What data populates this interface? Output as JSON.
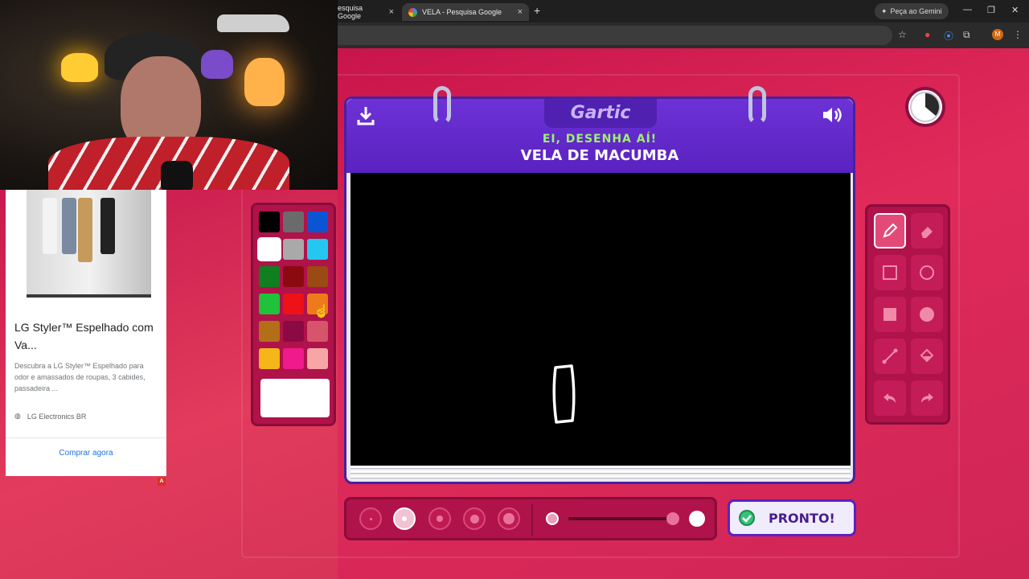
{
  "browser": {
    "tabs": [
      {
        "title": "esquisa Google",
        "close": "×"
      },
      {
        "title": "VELA - Pesquisa Google",
        "close": "×"
      }
    ],
    "new_tab": "+",
    "gemini_label": "Peça ao Gemini",
    "window_controls": {
      "minimize": "—",
      "restore": "❐",
      "close": "✕"
    },
    "profile_initial": "M"
  },
  "ad": {
    "title": "LG Styler™ Espelhado com Va...",
    "description": "Descubra a LG Styler™ Espelhado para odor e amassados de roupas, 3 cabides, passadeira ...",
    "source": "LG Electronics BR",
    "cta": "Comprar agora",
    "badge": "A"
  },
  "game": {
    "logo": "Gartic",
    "subtitle": "EI, DESENHA AÍ!",
    "word": "VELA DE MACUMBA",
    "palette": {
      "colors": [
        [
          "#000000",
          "#6b6b6b",
          "#0b55d4"
        ],
        [
          "#ffffff",
          "#a9a9a9",
          "#26c6f2"
        ],
        [
          "#0f7f1f",
          "#8a0a10",
          "#9a4a12"
        ],
        [
          "#1fc23a",
          "#ee1118",
          "#ef7a1c"
        ],
        [
          "#b36e1a",
          "#8c0a44",
          "#d6556a"
        ],
        [
          "#f6b51a",
          "#f01a8c",
          "#f7a6a6"
        ]
      ],
      "selected": "#ffffff"
    },
    "tools": [
      "pencil-icon",
      "eraser-icon",
      "rectangle-outline-icon",
      "circle-outline-icon",
      "rectangle-fill-icon",
      "circle-fill-icon",
      "line-icon",
      "fill-bucket-icon",
      "undo-icon",
      "redo-icon"
    ],
    "selected_tool": "pencil-icon",
    "brush_sizes_selected": 2,
    "ready_label": "PRONTO!"
  }
}
